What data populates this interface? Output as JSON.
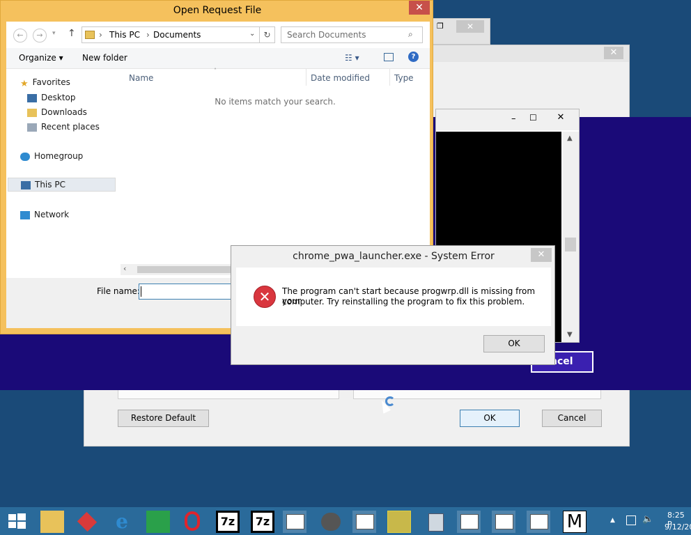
{
  "bg_dialog": {
    "close_glyph": "✕",
    "restore_default": "Restore Default",
    "ok": "OK",
    "cancel": "Cancel"
  },
  "small_window": {
    "restore_glyph": "❐",
    "close_glyph": "✕"
  },
  "purple_overlay": {
    "cancel_fragment": "ncel"
  },
  "console": {
    "minimize": "–",
    "maximize": "☐",
    "close": "✕"
  },
  "open_dialog": {
    "title": "Open Request File",
    "close_glyph": "✕",
    "address": {
      "root": "This PC",
      "sep": "›",
      "folder": "Documents"
    },
    "search_placeholder": "Search Documents",
    "toolbar": {
      "organize": "Organize ▾",
      "new_folder": "New folder"
    },
    "nav": {
      "favorites": "Favorites",
      "desktop": "Desktop",
      "downloads": "Downloads",
      "recent": "Recent places",
      "homegroup": "Homegroup",
      "this_pc": "This PC",
      "network": "Network"
    },
    "columns": {
      "name": "Name",
      "date": "Date modified",
      "type": "Type"
    },
    "empty_message": "No items match your search.",
    "file_name_label": "File name:",
    "file_name_value": ""
  },
  "error_dialog": {
    "title": "chrome_pwa_launcher.exe - System Error",
    "close_glyph": "✕",
    "message_line1": "The program can't start because progwrp.dll is missing from your",
    "message_line2": "computer. Try reinstalling the program to fix this problem.",
    "ok": "OK"
  },
  "taskbar": {
    "sevenzip_1": "7z",
    "sevenzip_2": "7z",
    "m_app": "M",
    "time": "8:25 P",
    "date": "9/12/20"
  },
  "colors": {
    "desktop": "#1a4a78",
    "overlay_purple": "#1a0a78",
    "dialog_frame": "#f5c15d",
    "error_red": "#d9363e",
    "taskbar": "#2a6a9a"
  }
}
